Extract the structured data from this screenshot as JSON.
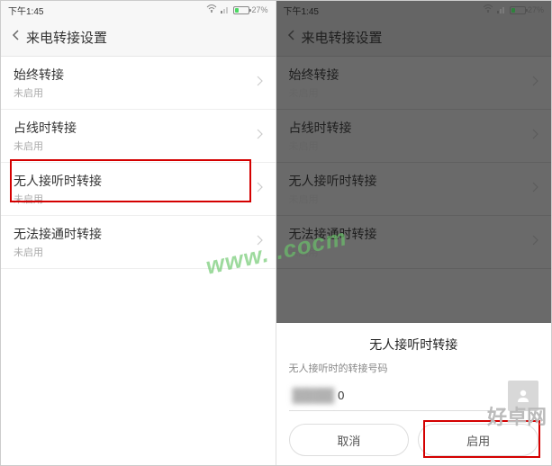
{
  "status": {
    "time": "下午1:45",
    "battery_pct": "27%"
  },
  "nav": {
    "title": "来电转接设置"
  },
  "items": [
    {
      "title": "始终转接",
      "sub": "未启用"
    },
    {
      "title": "占线时转接",
      "sub": "未启用"
    },
    {
      "title": "无人接听时转接",
      "sub": "未启用"
    },
    {
      "title": "无法接通时转接",
      "sub": "未启用"
    }
  ],
  "sheet": {
    "title": "无人接听时转接",
    "label": "无人接听时的转接号码",
    "input_value": "0",
    "cancel": "取消",
    "confirm": "启用"
  },
  "watermark": "www.    .cocm",
  "watermark2": "好卓网"
}
